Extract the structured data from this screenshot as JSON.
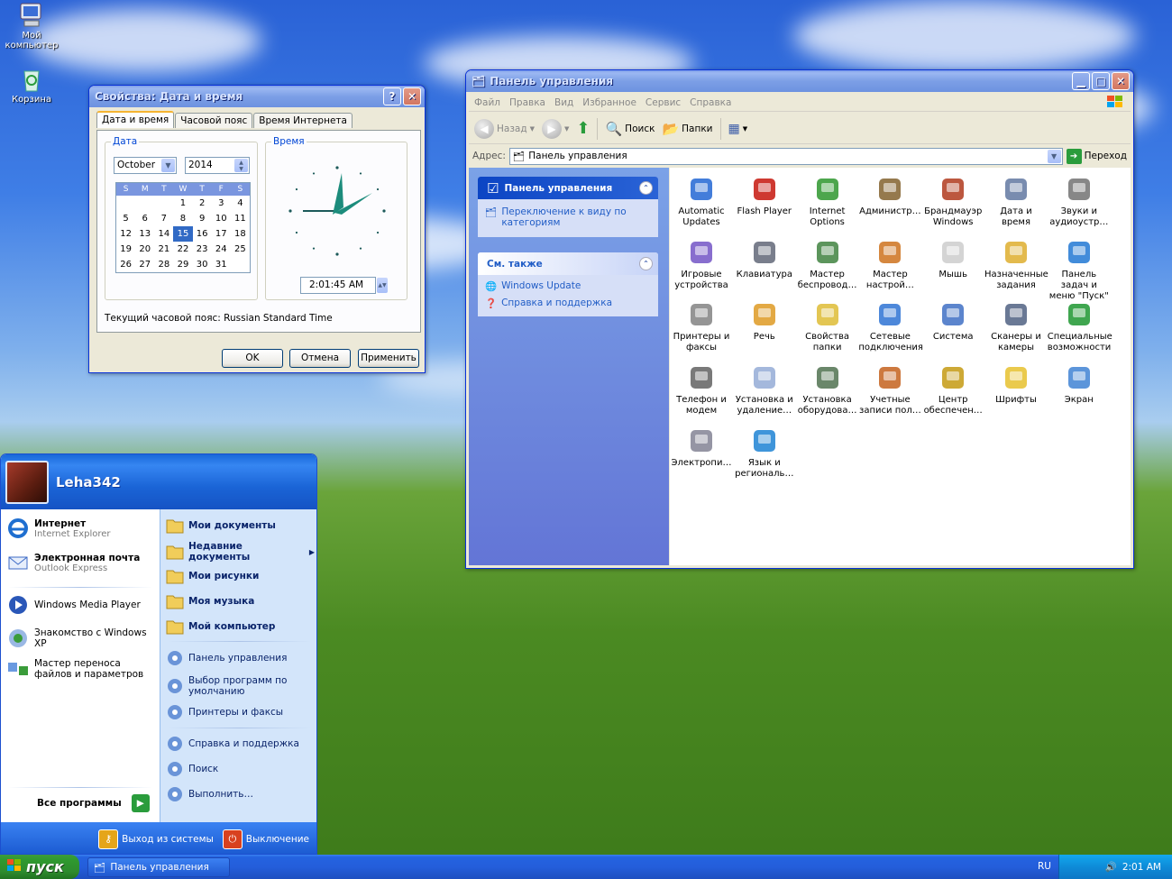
{
  "desktop": {
    "icons": [
      {
        "label": "Мой компьютер"
      },
      {
        "label": "Корзина"
      }
    ]
  },
  "datetime_dialog": {
    "title": "Свойства: Дата и время",
    "tabs": [
      "Дата и время",
      "Часовой пояс",
      "Время Интернета"
    ],
    "date_group": "Дата",
    "time_group": "Время",
    "month": "October",
    "year": "2014",
    "weekdays": [
      "S",
      "M",
      "T",
      "W",
      "T",
      "F",
      "S"
    ],
    "weeks": [
      [
        "",
        "",
        "",
        "1",
        "2",
        "3",
        "4"
      ],
      [
        "5",
        "6",
        "7",
        "8",
        "9",
        "10",
        "11"
      ],
      [
        "12",
        "13",
        "14",
        "15",
        "16",
        "17",
        "18"
      ],
      [
        "19",
        "20",
        "21",
        "22",
        "23",
        "24",
        "25"
      ],
      [
        "26",
        "27",
        "28",
        "29",
        "30",
        "31",
        ""
      ]
    ],
    "selected_day": "15",
    "time_value": "2:01:45 AM",
    "timezone_text": "Текущий часовой пояс: Russian Standard Time",
    "ok": "OK",
    "cancel": "Отмена",
    "apply": "Применить"
  },
  "control_panel": {
    "title": "Панель управления",
    "menu": [
      "Файл",
      "Правка",
      "Вид",
      "Избранное",
      "Сервис",
      "Справка"
    ],
    "toolbar": {
      "back": "Назад",
      "search": "Поиск",
      "folders": "Папки"
    },
    "address_label": "Адрес:",
    "address_value": "Панель управления",
    "go": "Переход",
    "task_box_title": "Панель управления",
    "switch_view": "Переключение к виду по категориям",
    "see_also_title": "См. также",
    "see_also": [
      "Windows Update",
      "Справка и поддержка"
    ],
    "items": [
      "Automatic Updates",
      "Flash Player",
      "Internet Options",
      "Администр…",
      "Брандмауэр Windows",
      "Дата и время",
      "Звуки и аудиоустр…",
      "Игровые устройства",
      "Клавиатура",
      "Мастер беспровод…",
      "Мастер настрой…",
      "Мышь",
      "Назначенные задания",
      "Панель задач и меню \"Пуск\"",
      "Принтеры и факсы",
      "Речь",
      "Свойства папки",
      "Сетевые подключения",
      "Система",
      "Сканеры и камеры",
      "Специальные возможности",
      "Телефон и модем",
      "Установка и удаление…",
      "Установка оборудова…",
      "Учетные записи пол…",
      "Центр обеспечен…",
      "Шрифты",
      "Экран",
      "Электропи…",
      "Язык и региональ…"
    ]
  },
  "start_menu": {
    "user": "Leha342",
    "pinned": [
      {
        "title": "Интернет",
        "sub": "Internet Explorer"
      },
      {
        "title": "Электронная почта",
        "sub": "Outlook Express"
      }
    ],
    "recent": [
      "Windows Media Player",
      "Знакомство с Windows XP",
      "Мастер переноса файлов и параметров"
    ],
    "all_programs": "Все программы",
    "right_bold": [
      "Мои документы",
      "Недавние документы",
      "Мои рисунки",
      "Моя музыка",
      "Мой компьютер"
    ],
    "right_normal": [
      "Панель управления",
      "Выбор программ по умолчанию",
      "Принтеры и факсы",
      "Справка и поддержка",
      "Поиск",
      "Выполнить…"
    ],
    "logoff": "Выход из системы",
    "shutdown": "Выключение"
  },
  "taskbar": {
    "start": "пуск",
    "task": "Панель управления",
    "lang": "RU",
    "clock": "2:01 AM"
  }
}
